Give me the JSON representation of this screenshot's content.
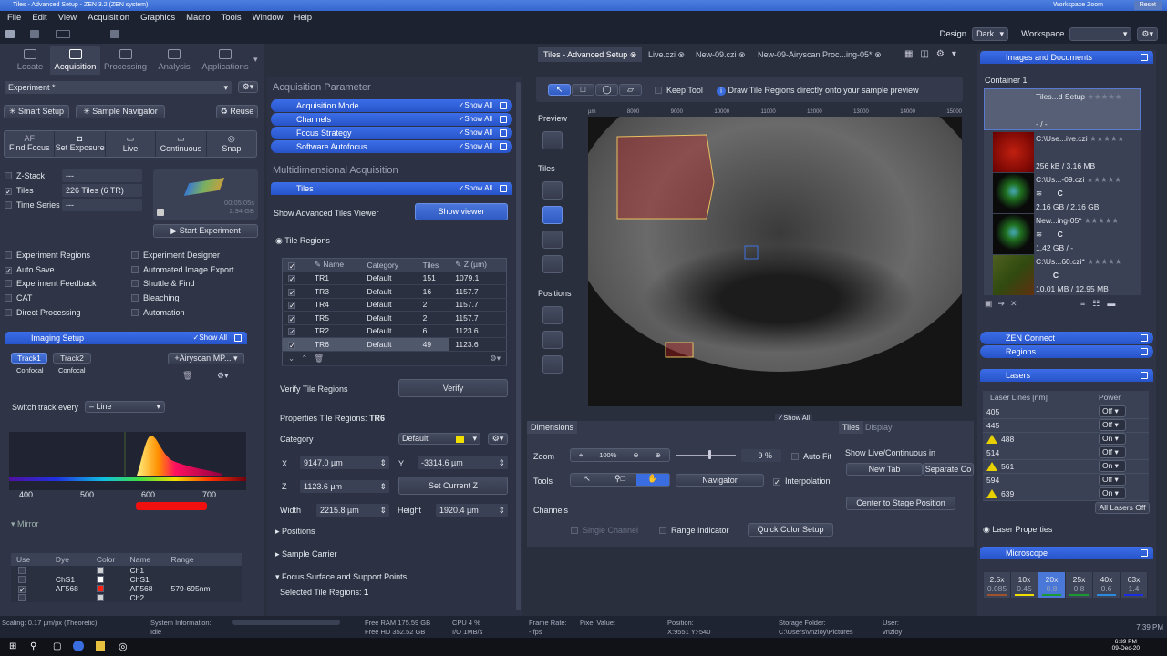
{
  "window": {
    "title": "Tiles - Advanced Setup - ZEN 3.2 (ZEN system)",
    "workspace_zoom": "Workspace Zoom",
    "reset": "Reset"
  },
  "menu": [
    "File",
    "Edit",
    "View",
    "Acquisition",
    "Graphics",
    "Macro",
    "Tools",
    "Window",
    "Help"
  ],
  "design": {
    "label": "Design",
    "value": "Dark",
    "workspace_label": "Workspace",
    "workspace_value": ""
  },
  "main_tabs": [
    "Locate",
    "Acquisition",
    "Processing",
    "Analysis",
    "Applications"
  ],
  "left": {
    "experiment": "Experiment *",
    "smart_setup": "Smart Setup",
    "sample_navigator": "Sample Navigator",
    "reuse": "Reuse",
    "acq_buttons": [
      {
        "icon": "AF",
        "label": "Find Focus"
      },
      {
        "icon": "camera",
        "label": "Set Exposure"
      },
      {
        "icon": "live",
        "label": "Live"
      },
      {
        "icon": "continuous",
        "label": "Continuous"
      },
      {
        "icon": "snap",
        "label": "Snap"
      }
    ],
    "dims": [
      {
        "label": "Z-Stack",
        "checked": false,
        "value": "---"
      },
      {
        "label": "Tiles",
        "checked": true,
        "value": "226 Tiles (6 TR)"
      },
      {
        "label": "Time Series",
        "checked": false,
        "value": "---"
      }
    ],
    "estimate_time": "00:05:05s",
    "estimate_size": "2.94 GB",
    "start": "Start Experiment",
    "options_left": [
      {
        "label": "Experiment Regions",
        "checked": false
      },
      {
        "label": "Auto Save",
        "checked": true
      },
      {
        "label": "Experiment Feedback",
        "checked": false
      },
      {
        "label": "CAT",
        "checked": false
      },
      {
        "label": "Direct Processing",
        "checked": false
      }
    ],
    "options_right": [
      {
        "label": "Experiment Designer",
        "checked": false
      },
      {
        "label": "Automated Image Export",
        "checked": false
      },
      {
        "label": "Shuttle & Find",
        "checked": false
      },
      {
        "label": "Bleaching",
        "checked": false
      },
      {
        "label": "Automation",
        "checked": false
      }
    ],
    "imaging_setup": "Imaging Setup",
    "show_all": "✓Show All",
    "tracks": [
      {
        "name": "Track1",
        "mode": "Confocal"
      },
      {
        "name": "Track2",
        "mode": "Confocal"
      }
    ],
    "airyscan": "+Airyscan MP...",
    "switch_track": "Switch track every",
    "switch_value": "– Line",
    "spectrum_ticks": [
      "400",
      "500",
      "600",
      "700"
    ],
    "mirror": "Mirror",
    "channel_headers": [
      "Use",
      "Dye",
      "Color",
      "Name",
      "Range"
    ],
    "channels": [
      {
        "use": false,
        "dye": "",
        "color": "#d0d0d0",
        "name": "Ch1",
        "range": ""
      },
      {
        "use": false,
        "dye": "ChS1",
        "color": "#ffffff",
        "name": "ChS1",
        "range": ""
      },
      {
        "use": true,
        "dye": "AF568",
        "color": "#ff2010",
        "name": "AF568",
        "range": "579-695nm"
      },
      {
        "use": false,
        "dye": "",
        "color": "#d0d0d0",
        "name": "Ch2",
        "range": ""
      }
    ]
  },
  "middle": {
    "acq_param": "Acquisition Parameter",
    "acq_items": [
      "Acquisition Mode",
      "Channels",
      "Focus Strategy",
      "Software Autofocus"
    ],
    "multidim": "Multidimensional Acquisition",
    "tiles": "Tiles",
    "show_adv": "Show Advanced Tiles Viewer",
    "show_viewer": "Show viewer",
    "tile_regions": "Tile Regions",
    "table_headers": [
      "Name",
      "Category",
      "Tiles",
      "Z (µm)"
    ],
    "rows": [
      [
        "TR1",
        "Default",
        "151",
        "1079.1"
      ],
      [
        "TR3",
        "Default",
        "16",
        "1157.7"
      ],
      [
        "TR4",
        "Default",
        "2",
        "1157.7"
      ],
      [
        "TR5",
        "Default",
        "2",
        "1157.7"
      ],
      [
        "TR2",
        "Default",
        "6",
        "1123.6"
      ],
      [
        "TR6",
        "Default",
        "49",
        "1123.6"
      ]
    ],
    "verify_label": "Verify Tile Regions",
    "verify": "Verify",
    "props_label": "Properties Tile Regions:",
    "props_sel": "TR6",
    "category_label": "Category",
    "category": "Default",
    "category_color": "#f0e000",
    "x_label": "X",
    "x": "9147.0 µm",
    "y_label": "Y",
    "y": "-3314.6 µm",
    "z_label": "Z",
    "z": "1123.6 µm",
    "set_z": "Set Current Z",
    "w_label": "Width",
    "w": "2215.8 µm",
    "h_label": "Height",
    "h": "1920.4 µm",
    "positions": "Positions",
    "sample_carrier": "Sample Carrier",
    "focus_surface": "Focus Surface and Support Points",
    "selected_label": "Selected Tile Regions:",
    "selected": "1"
  },
  "center": {
    "tabs": [
      "Tiles - Advanced Setup",
      "Live.czi",
      "New-09.czi",
      "New-09-Airyscan Proc...ing-05*"
    ],
    "keep_tool": "Keep Tool",
    "hint": "Draw Tile Regions directly onto your sample preview",
    "side": [
      "Preview",
      "Tiles",
      "Positions"
    ],
    "ruler": [
      "µm",
      "8000",
      "9000",
      "10000",
      "11000",
      "12000",
      "13000",
      "14000",
      "15000"
    ],
    "show_all": "✓Show All",
    "dim_tab": "Dimensions",
    "zoom_label": "Zoom",
    "zoom_100": "100%",
    "zoom_value": "9 %",
    "auto_fit": "Auto Fit",
    "tools_label": "Tools",
    "navigator": "Navigator",
    "interpolation": "Interpolation",
    "channels_label": "Channels",
    "single_channel": "Single Channel",
    "range_indicator": "Range Indicator",
    "quick_color": "Quick Color Setup",
    "side_tabs": [
      "Tiles",
      "Display"
    ],
    "show_live": "Show Live/Continuous in",
    "new_tab": "New Tab",
    "separate": "Separate Co",
    "center_stage": "Center to Stage Position"
  },
  "right": {
    "images_docs": "Images and Documents",
    "container": "Container 1",
    "docs": [
      {
        "name": "Tiles...d Setup",
        "info": "- / -",
        "c": ""
      },
      {
        "name": "C:\\Use...ive.czi",
        "info": "256 kB / 3.16 MB",
        "c": ""
      },
      {
        "name": "C:\\Us...-09.czi",
        "info": "2.16 GB / 2.16 GB",
        "c": "C"
      },
      {
        "name": "New...ing-05*",
        "info": "1.42 GB / -",
        "c": "C"
      },
      {
        "name": "C:\\Us...60.czi*",
        "info": "10.01 MB / 12.95 MB",
        "c": "C"
      }
    ],
    "zen_connect": "ZEN Connect",
    "regions": "Regions",
    "lasers": "Lasers",
    "laser_headers": [
      "Laser Lines [nm]",
      "Power"
    ],
    "laser_lines": [
      {
        "nm": "405",
        "power": "Off",
        "warn": false
      },
      {
        "nm": "445",
        "power": "Off",
        "warn": false
      },
      {
        "nm": "488",
        "power": "On",
        "warn": true
      },
      {
        "nm": "514",
        "power": "Off",
        "warn": false
      },
      {
        "nm": "561",
        "power": "On",
        "warn": true
      },
      {
        "nm": "594",
        "power": "Off",
        "warn": false
      },
      {
        "nm": "639",
        "power": "On",
        "warn": true
      }
    ],
    "all_off": "All Lasers Off",
    "laser_props": "Laser Properties",
    "microscope": "Microscope",
    "objectives": [
      {
        "mag": "2.5x",
        "na": "0.085",
        "color": "#a0522d"
      },
      {
        "mag": "10x",
        "na": "0.45",
        "color": "#f0e000"
      },
      {
        "mag": "20x",
        "na": "0.8",
        "color": "#1a9a30"
      },
      {
        "mag": "25x",
        "na": "0.8",
        "color": "#1a9a30"
      },
      {
        "mag": "40x",
        "na": "0.6",
        "color": "#2a8ae0"
      },
      {
        "mag": "63x",
        "na": "1.4",
        "color": "#1a30e0"
      }
    ]
  },
  "status": {
    "scaling": "Scaling:  0.17 µm/px (Theoretic)",
    "sysinfo_label": "System Information:",
    "sysinfo": "Idle",
    "ram": "Free RAM  175.59 GB",
    "hd": "Free HD   352.52 GB",
    "cpu": "CPU  4 %",
    "io": "I/O   1MB/s",
    "frame_label": "Frame Rate:",
    "frame": "- fps",
    "pixel_label": "Pixel Value:",
    "pos_label": "Position:",
    "pos": "X:9551  Y:-540",
    "storage_label": "Storage Folder:",
    "storage": "C:\\Users\\vnzloy\\Pictures",
    "user_label": "User:",
    "user": "vnzloy",
    "time": "7:39 PM"
  },
  "taskbar": {
    "time": "6:39 PM",
    "date": "09-Dec-20"
  }
}
